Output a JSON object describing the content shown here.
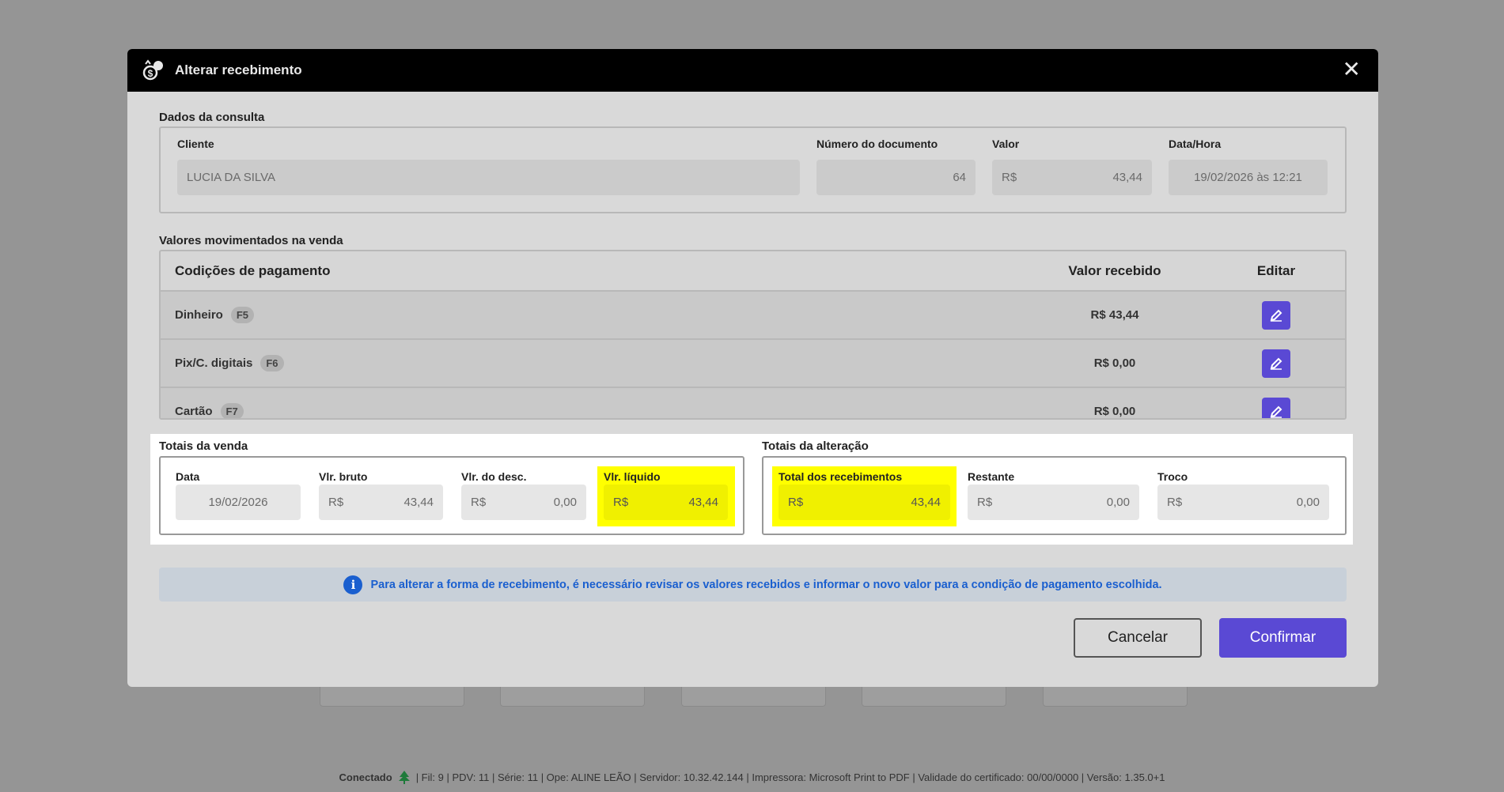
{
  "dialog": {
    "title": "Alterar recebimento",
    "close_label": "✕"
  },
  "consulta": {
    "section": "Dados da consulta",
    "cliente_label": "Cliente",
    "cliente": "LUCIA DA SILVA",
    "documento_label": "Número do documento",
    "documento": "64",
    "valor_label": "Valor",
    "valor_currency": "R$",
    "valor": "43,44",
    "datahora_label": "Data/Hora",
    "datahora": "19/02/2026 às 12:21"
  },
  "movimentados": {
    "section": "Valores movimentados na venda",
    "headers": [
      "Codições de pagamento",
      "Valor recebido",
      "Editar"
    ],
    "rows": [
      {
        "name": "Dinheiro",
        "key": "F5",
        "value": "R$ 43,44"
      },
      {
        "name": "Pix/C. digitais",
        "key": "F6",
        "value": "R$ 0,00"
      },
      {
        "name": "Cartão",
        "key": "F7",
        "value": "R$ 0,00"
      }
    ]
  },
  "totais_venda": {
    "section": "Totais da venda",
    "data_label": "Data",
    "data": "19/02/2026",
    "bruto_label": "Vlr. bruto",
    "bruto": "43,44",
    "desc_label": "Vlr. do desc.",
    "desc": "0,00",
    "liquido_label": "Vlr. líquido",
    "liquido": "43,44",
    "currency": "R$"
  },
  "totais_alteracao": {
    "section": "Totais da alteração",
    "total_label": "Total dos recebimentos",
    "total": "43,44",
    "restante_label": "Restante",
    "restante": "0,00",
    "troco_label": "Troco",
    "troco": "0,00",
    "currency": "R$"
  },
  "info": "Para alterar a forma de recebimento, é necessário revisar os valores recebidos e informar o novo valor para a condição de pagamento escolhida.",
  "buttons": {
    "cancel": "Cancelar",
    "confirm": "Confirmar"
  },
  "status": {
    "connected": "Conectado",
    "details": "| Fil: 9 | PDV: 11 | Série: 11 | Ope: ALINE LEÃO | Servidor: 10.32.42.144 | Impressora: Microsoft Print to PDF | Validade do certificado: 00/00/0000 | Versão: 1.35.0+1"
  },
  "colors": {
    "accent": "#5a49d4",
    "highlight": "#ffff00",
    "info": "#1a5fcf"
  }
}
